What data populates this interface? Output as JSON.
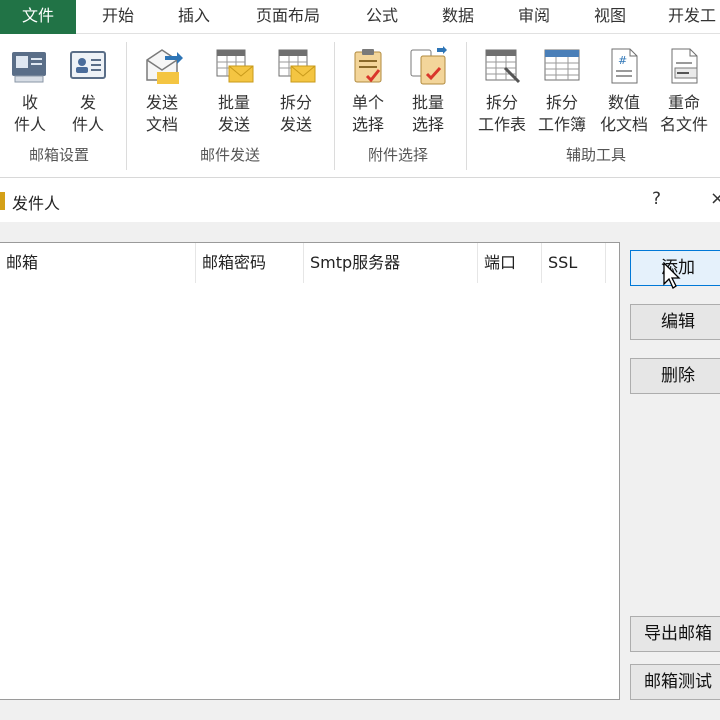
{
  "tabs": [
    "文件",
    "开始",
    "插入",
    "页面布局",
    "公式",
    "数据",
    "审阅",
    "视图",
    "开发工"
  ],
  "ribbon": {
    "groups": [
      {
        "label": "邮箱设置",
        "buttons": [
          {
            "line1": "收",
            "line2": "件人",
            "icon": "inbox-card-icon"
          },
          {
            "line1": "发",
            "line2": "件人",
            "icon": "contact-card-icon"
          }
        ]
      },
      {
        "label": "邮件发送",
        "buttons": [
          {
            "line1": "发送",
            "line2": "文档",
            "icon": "send-envelope-icon"
          },
          {
            "line1": "批量",
            "line2": "发送",
            "icon": "bulk-send-sheet-icon"
          },
          {
            "line1": "拆分",
            "line2": "发送",
            "icon": "split-send-sheet-icon"
          }
        ]
      },
      {
        "label": "附件选择",
        "buttons": [
          {
            "line1": "单个",
            "line2": "选择",
            "icon": "clipboard-check-icon"
          },
          {
            "line1": "批量",
            "line2": "选择",
            "icon": "multi-clipboard-check-icon"
          }
        ]
      },
      {
        "label": "辅助工具",
        "buttons": [
          {
            "line1": "拆分",
            "line2": "工作表",
            "icon": "split-worksheet-icon"
          },
          {
            "line1": "拆分",
            "line2": "工作簿",
            "icon": "split-workbook-icon"
          },
          {
            "line1": "数值",
            "line2": "化文档",
            "icon": "numeric-document-icon"
          },
          {
            "line1": "重命",
            "line2": "名文件",
            "icon": "rename-file-icon"
          }
        ]
      }
    ]
  },
  "dialog": {
    "title": "发件人",
    "help": "?",
    "close": "×",
    "columns": [
      "邮箱",
      "邮箱密码",
      "Smtp服务器",
      "端口",
      "SSL"
    ],
    "buttons": {
      "add": "添加",
      "edit": "编辑",
      "delete": "删除",
      "export": "导出邮箱",
      "test": "邮箱测试"
    }
  },
  "colors": {
    "accent": "#217346",
    "focus": "#0078d7"
  }
}
